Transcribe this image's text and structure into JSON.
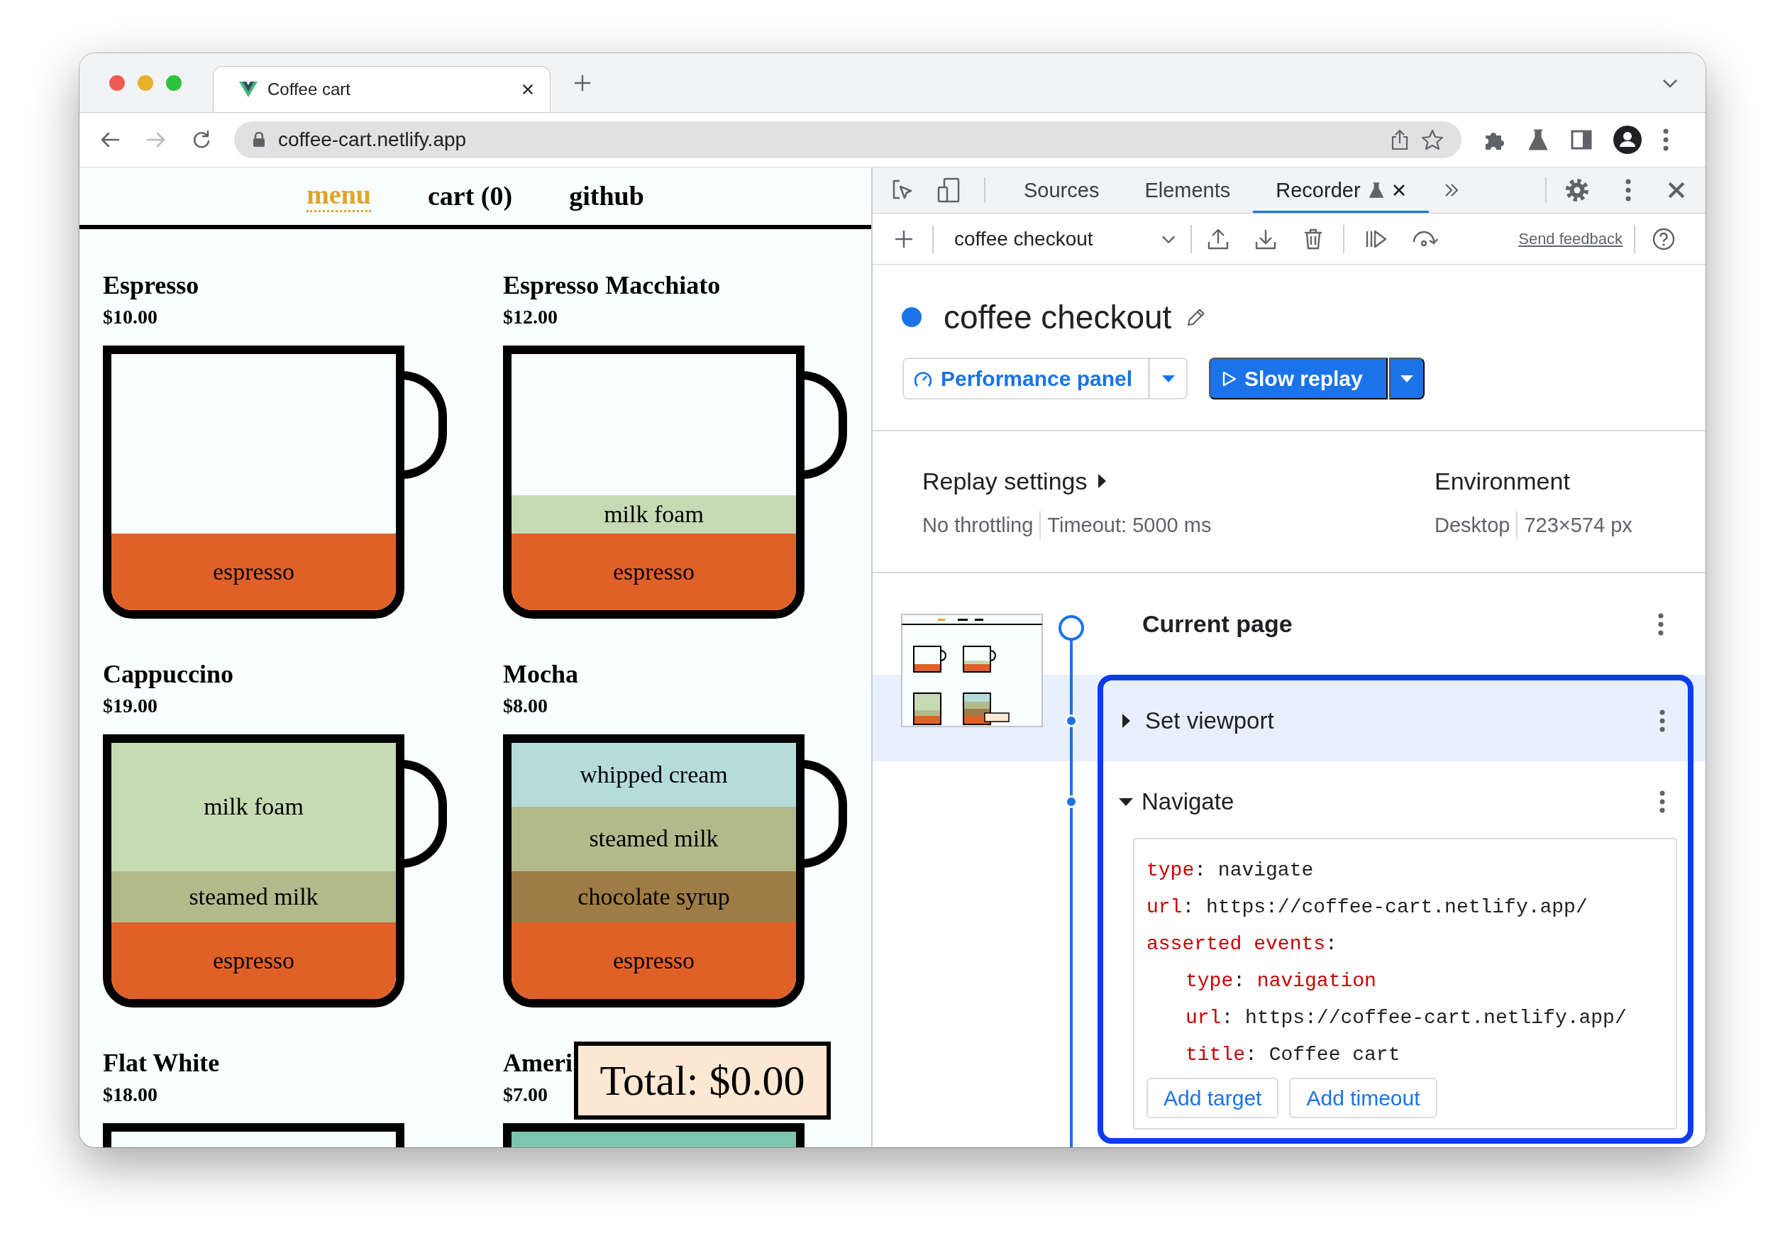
{
  "browser": {
    "tab_title": "Coffee cart",
    "address": "coffee-cart.netlify.app"
  },
  "page": {
    "nav": [
      {
        "label": "menu",
        "selected": true
      },
      {
        "label": "cart (0)",
        "selected": false
      },
      {
        "label": "github",
        "selected": false
      }
    ],
    "products": [
      {
        "name": "Espresso",
        "price": "$10.00",
        "layers": [
          {
            "label": "espresso",
            "color": "#e06128",
            "kind": "regular"
          }
        ]
      },
      {
        "name": "Espresso Macchiato",
        "price": "$12.00",
        "layers": [
          {
            "label": "milk foam",
            "color": "#c6dbb3",
            "kind": "thin"
          },
          {
            "label": "espresso",
            "color": "#e06128",
            "kind": "regular"
          }
        ]
      },
      {
        "name": "Cappuccino",
        "price": "$19.00",
        "layers": [
          {
            "label": "milk foam",
            "color": "#c6dbb3",
            "kind": "large"
          },
          {
            "label": "steamed milk",
            "color": "#b2ba8b",
            "kind": "small"
          },
          {
            "label": "espresso",
            "color": "#e06128",
            "kind": "regular"
          }
        ]
      },
      {
        "name": "Mocha",
        "price": "$8.00",
        "layers": [
          {
            "label": "whipped cream",
            "color": "#b5dcdb",
            "kind": "medium"
          },
          {
            "label": "steamed milk",
            "color": "#b2ba8b",
            "kind": "medium"
          },
          {
            "label": "chocolate syrup",
            "color": "#9d7c45",
            "kind": "small"
          },
          {
            "label": "espresso",
            "color": "#e06128",
            "kind": "regular"
          }
        ]
      },
      {
        "name": "Flat White",
        "price": "$18.00"
      },
      {
        "name": "Ameri",
        "price": "$7.00",
        "layers": [
          {
            "color": "#7cc5af",
            "kind": "full"
          }
        ]
      }
    ],
    "total": "Total: $0.00"
  },
  "devtools": {
    "tabs": [
      {
        "label": "Sources",
        "selected": false,
        "experimental": false,
        "closable": false
      },
      {
        "label": "Elements",
        "selected": false,
        "experimental": false,
        "closable": false
      },
      {
        "label": "Recorder",
        "selected": true,
        "experimental": true,
        "closable": true
      }
    ],
    "recording_select": "coffee checkout",
    "send_feedback": "Send feedback",
    "recording": {
      "title": "coffee checkout",
      "performance_action": "Performance panel",
      "replay_action": "Slow replay"
    },
    "replay_settings": {
      "title": "Replay settings",
      "items": [
        "No throttling",
        "Timeout: 5000 ms"
      ]
    },
    "environment": {
      "title": "Environment",
      "items": [
        "Desktop",
        "723×574 px"
      ]
    },
    "section": {
      "title": "Current page",
      "focused": true,
      "steps": [
        {
          "title": "Set viewport",
          "selected": true,
          "expanded": false
        },
        {
          "title": "Navigate",
          "selected": false,
          "expanded": true,
          "details": [
            {
              "key": "type",
              "sep": ": ",
              "value": "navigate",
              "kind": "text"
            },
            {
              "key": "url",
              "sep": ": ",
              "value": "https://coffee-cart.netlify.app/",
              "kind": "text"
            },
            {
              "key": "asserted events",
              "sep": ":",
              "kind": "group",
              "children": [
                {
                  "key": "type",
                  "sep": ": ",
                  "value": "navigation",
                  "kind": "keyword"
                },
                {
                  "key": "url",
                  "sep": ": ",
                  "value": "https://coffee-cart.netlify.app/",
                  "kind": "text"
                },
                {
                  "key": "title",
                  "sep": ": ",
                  "value": "Coffee cart",
                  "kind": "text"
                }
              ]
            }
          ],
          "actions": [
            "Add target",
            "Add timeout"
          ]
        }
      ]
    }
  }
}
